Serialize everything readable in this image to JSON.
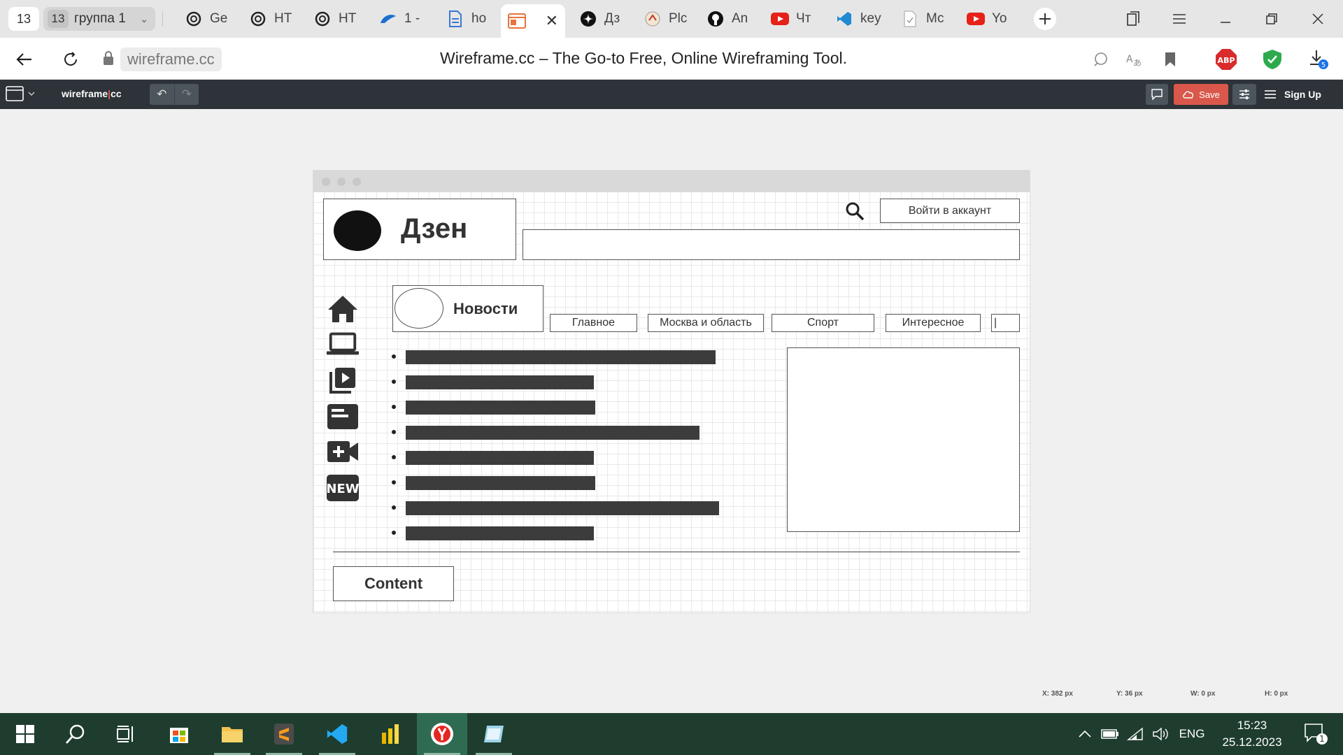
{
  "browser": {
    "tab_group_count": "13",
    "tab_group": {
      "count": "13",
      "name": "группа 1"
    },
    "tabs": [
      {
        "label": "Ge",
        "icon": "openai-icon"
      },
      {
        "label": "НТ",
        "icon": "openai-icon"
      },
      {
        "label": "НТ",
        "icon": "openai-icon"
      },
      {
        "label": "1 -",
        "icon": "cloud-icon"
      },
      {
        "label": "ho",
        "icon": "document-icon"
      },
      {
        "label": "",
        "icon": "wireframe-icon",
        "active": true
      },
      {
        "label": "Дз",
        "icon": "dzen-icon"
      },
      {
        "label": "Plc",
        "icon": "plc-icon"
      },
      {
        "label": "An",
        "icon": "github-icon"
      },
      {
        "label": "Чт",
        "icon": "youtube-icon"
      },
      {
        "label": "key",
        "icon": "vscode-icon"
      },
      {
        "label": "Мс",
        "icon": "file-icon"
      },
      {
        "label": "Yo",
        "icon": "youtube-icon"
      }
    ],
    "url": "wireframe.cc",
    "page_title": "Wireframe.cc – The Go-to Free, Online Wireframing Tool.",
    "downloads_badge": "5",
    "abp_label": "ABP"
  },
  "app": {
    "logo_left": "wireframe",
    "logo_sep": "|",
    "logo_right": "cc",
    "undo": "↶",
    "redo": "↷",
    "save_label": "Save",
    "signup_label": "Sign Up"
  },
  "wireframe": {
    "logo_text": "Дзен",
    "login_label": "Войти в аккаунт",
    "news_label": "Новости",
    "tabs": [
      "Главное",
      "Москва и область",
      "Спорт",
      "Интересное",
      "|"
    ],
    "content_label": "Content"
  },
  "status": {
    "x": "X: 382 px",
    "y": "Y: 36 px",
    "w": "W: 0 px",
    "h": "H: 0 px"
  },
  "taskbar": {
    "language": "ENG",
    "time": "15:23",
    "date": "25.12.2023",
    "notification_count": "1"
  },
  "colors": {
    "accent_save": "#d9584b",
    "toolbar_bg": "#2d3338",
    "taskbar_bg": "#1e3d2f"
  }
}
